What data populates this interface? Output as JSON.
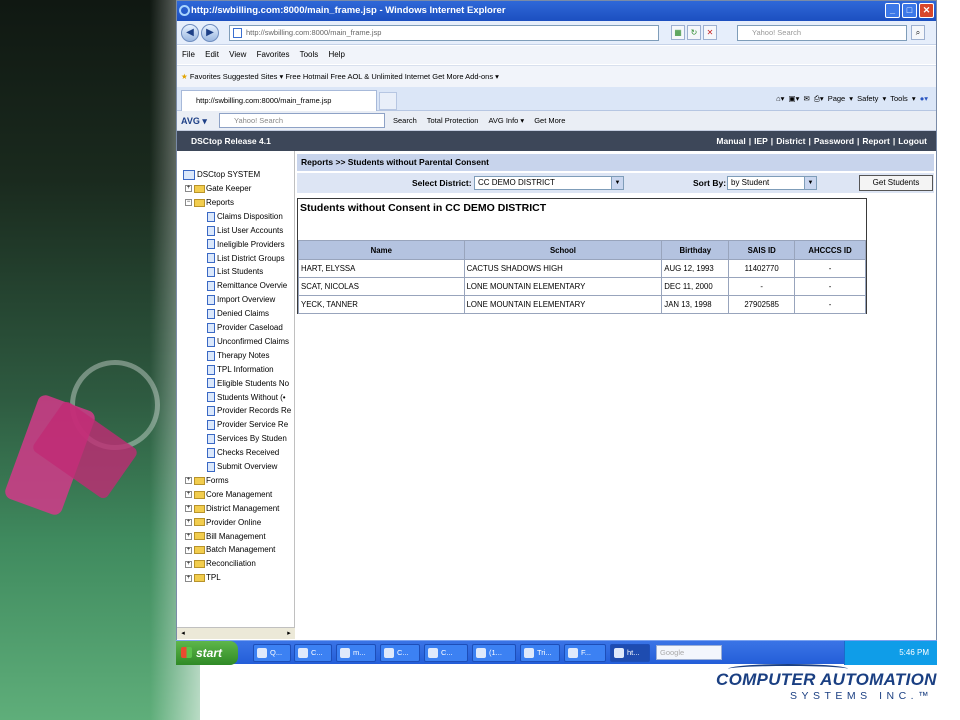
{
  "browser": {
    "title": "http://swbilling.com:8000/main_frame.jsp - Windows Internet Explorer",
    "address": "http://swbilling.com:8000/main_frame.jsp",
    "search_placeholder": "Yahoo! Search",
    "menu": [
      "File",
      "Edit",
      "View",
      "Favorites",
      "Tools",
      "Help"
    ],
    "favorites_label": "Favorites",
    "fav_links": [
      "Suggested Sites ▾",
      "Free Hotmail",
      "Free AOL & Unlimited Internet",
      "Get More Add-ons ▾"
    ],
    "tab_title": "http://swbilling.com:8000/main_frame.jsp",
    "command_bar": [
      "Page ▾",
      "Safety ▾",
      "Tools ▾"
    ],
    "avg": {
      "logo": "AVG ▾",
      "search_placeholder": "Yahoo! Search",
      "items": [
        "Search",
        "Total Protection",
        "AVG Info ▾",
        "Get More"
      ]
    }
  },
  "app": {
    "release": "DSCtop Release 4.1",
    "links": [
      "Manual",
      "IEP",
      "District",
      "Password",
      "Report",
      "Logout"
    ]
  },
  "tree": {
    "root": "DSCtop SYSTEM",
    "items": [
      {
        "label": "Gate Keeper",
        "type": "folder",
        "level": 1,
        "expanded": false
      },
      {
        "label": "Reports",
        "type": "folder",
        "level": 1,
        "expanded": true
      },
      {
        "label": "Claims Disposition",
        "type": "doc",
        "level": 2
      },
      {
        "label": "List User Accounts",
        "type": "doc",
        "level": 2
      },
      {
        "label": "Ineligible Providers",
        "type": "doc",
        "level": 2
      },
      {
        "label": "List District Groups",
        "type": "doc",
        "level": 2
      },
      {
        "label": "List Students",
        "type": "doc",
        "level": 2
      },
      {
        "label": "Remittance Overvie",
        "type": "doc",
        "level": 2
      },
      {
        "label": "Import Overview",
        "type": "doc",
        "level": 2
      },
      {
        "label": "Denied Claims",
        "type": "doc",
        "level": 2
      },
      {
        "label": "Provider Caseload",
        "type": "doc",
        "level": 2
      },
      {
        "label": "Unconfirmed Claims",
        "type": "doc",
        "level": 2
      },
      {
        "label": "Therapy Notes",
        "type": "doc",
        "level": 2
      },
      {
        "label": "TPL Information",
        "type": "doc",
        "level": 2
      },
      {
        "label": "Eligible Students No",
        "type": "doc",
        "level": 2
      },
      {
        "label": "Students Without (•",
        "type": "doc",
        "level": 2
      },
      {
        "label": "Provider Records Re",
        "type": "doc",
        "level": 2
      },
      {
        "label": "Provider Service Re",
        "type": "doc",
        "level": 2
      },
      {
        "label": "Services By Studen",
        "type": "doc",
        "level": 2
      },
      {
        "label": "Checks Received",
        "type": "doc",
        "level": 2
      },
      {
        "label": "Submit Overview",
        "type": "doc",
        "level": 2
      },
      {
        "label": "Forms",
        "type": "folder",
        "level": 1,
        "expanded": false
      },
      {
        "label": "Core Management",
        "type": "folder",
        "level": 1,
        "expanded": false
      },
      {
        "label": "District Management",
        "type": "folder",
        "level": 1,
        "expanded": false
      },
      {
        "label": "Provider Online",
        "type": "folder",
        "level": 1,
        "expanded": false
      },
      {
        "label": "Bill Management",
        "type": "folder",
        "level": 1,
        "expanded": false
      },
      {
        "label": "Batch Management",
        "type": "folder",
        "level": 1,
        "expanded": false
      },
      {
        "label": "Reconciliation",
        "type": "folder",
        "level": 1,
        "expanded": false
      },
      {
        "label": "TPL",
        "type": "folder",
        "level": 1,
        "expanded": false
      }
    ]
  },
  "report": {
    "breadcrumb": "Reports >> Students without Parental Consent",
    "district_label": "Select District:",
    "district_value": "CC DEMO DISTRICT",
    "sort_label": "Sort By:",
    "sort_value": "by Student",
    "get_button": "Get Students",
    "results_title": "Students without Consent in CC DEMO DISTRICT",
    "columns": [
      "Name",
      "School",
      "Birthday",
      "SAIS ID",
      "AHCCCS ID"
    ],
    "rows": [
      [
        "HART, ELYSSA",
        "CACTUS SHADOWS HIGH",
        "AUG 12, 1993",
        "11402770",
        "-"
      ],
      [
        "SCAT, NICOLAS",
        "LONE MOUNTAIN ELEMENTARY",
        "DEC 11, 2000",
        "-",
        "-"
      ],
      [
        "YECK, TANNER",
        "LONE MOUNTAIN ELEMENTARY",
        "JAN 13, 1998",
        "27902585",
        "-"
      ]
    ]
  },
  "taskbar": {
    "start": "start",
    "buttons": [
      "Q...",
      "C...",
      "m...",
      "C...",
      "C...",
      "(1...",
      "Tri...",
      "F...",
      "ht..."
    ],
    "search_placeholder": "Google",
    "clock": "5:46 PM"
  },
  "logo": {
    "line1": "COMPUTER AUTOMATION",
    "line2": "SYSTEMS INC.™"
  }
}
